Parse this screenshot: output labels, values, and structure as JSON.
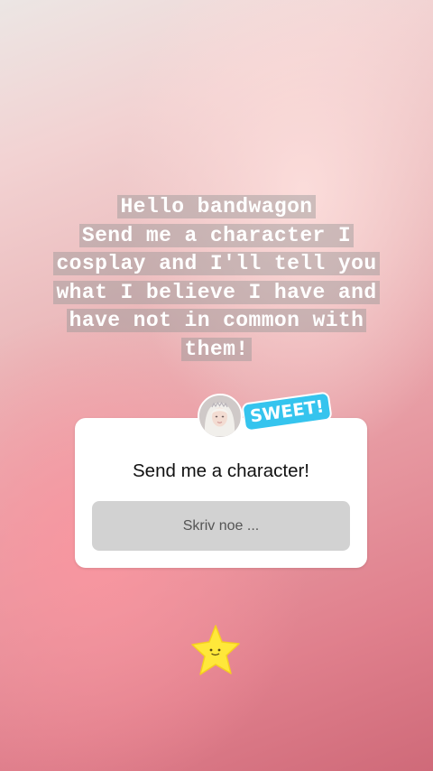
{
  "caption": {
    "lines": [
      "Hello bandwagon",
      "Send me a character I",
      "cosplay and I'll tell you",
      "what I believe I have and",
      "have not in common with",
      "them!"
    ]
  },
  "question_sticker": {
    "question": "Send me a character!",
    "placeholder": "Skriv noe ..."
  },
  "stickers": {
    "sweet_label": "SWEET!",
    "star": "star-sticker"
  },
  "colors": {
    "sweet_bg": "#35c4ee",
    "star_fill": "#ffe83a",
    "answer_field_bg": "#d2d2d2"
  }
}
